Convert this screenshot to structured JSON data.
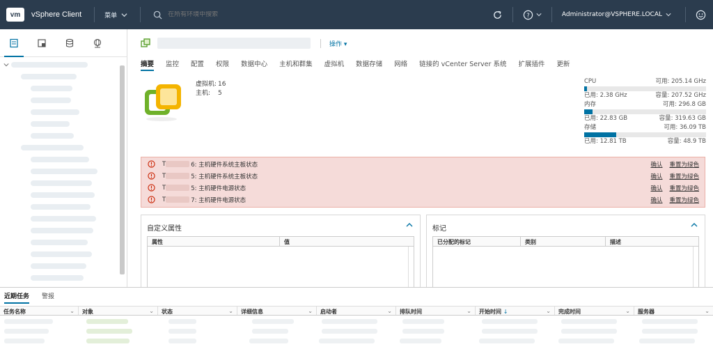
{
  "header": {
    "logo": "vm",
    "app_title": "vSphere Client",
    "menu_label": "菜单",
    "search_placeholder": "在所有环境中搜索",
    "user_label": "Administrator@VSPHERE.LOCAL",
    "icons": [
      "refresh-icon",
      "help-icon",
      "smiley-icon"
    ]
  },
  "navigator": {
    "tabs": [
      "hosts-clusters-icon",
      "vms-templates-icon",
      "storage-icon",
      "networking-icon"
    ],
    "active_tab_index": 0
  },
  "object": {
    "actions_label": "操作"
  },
  "tabs": [
    "摘要",
    "监控",
    "配置",
    "权限",
    "数据中心",
    "主机和群集",
    "虚拟机",
    "数据存储",
    "网络",
    "链接的 vCenter Server 系统",
    "扩展插件",
    "更新"
  ],
  "active_tab_index": 0,
  "summary": {
    "stats": [
      {
        "label": "虚拟机:",
        "value": "16"
      },
      {
        "label": "主机:",
        "value": "5"
      }
    ]
  },
  "resources": [
    {
      "name": "CPU",
      "free_label": "可用: 205.14 GHz",
      "used_label": "已用: 2.38 GHz",
      "capacity_label": "容量: 207.52 GHz",
      "used_fraction": 0.011
    },
    {
      "name": "内存",
      "free_label": "可用: 296.8 GB",
      "used_label": "已用: 22.83 GB",
      "capacity_label": "容量: 319.63 GB",
      "used_fraction": 0.071
    },
    {
      "name": "存储",
      "free_label": "可用: 36.09 TB",
      "used_label": "已用: 12.81 TB",
      "capacity_label": "容量: 48.9 TB",
      "used_fraction": 0.262
    }
  ],
  "alerts": {
    "rows": [
      {
        "prefix": "T",
        "suffix": "6: 主机硬件系统主板状态"
      },
      {
        "prefix": "T",
        "suffix": "5: 主机硬件系统主板状态"
      },
      {
        "prefix": "T",
        "suffix": "5: 主机硬件电源状态"
      },
      {
        "prefix": "T",
        "suffix": "7: 主机硬件电源状态"
      }
    ],
    "ack_label": "确认",
    "reset_label": "重置为绿色"
  },
  "custom_attributes": {
    "title": "自定义属性",
    "columns": [
      "属性",
      "值"
    ]
  },
  "tags": {
    "title": "标记",
    "columns": [
      "已分配的标记",
      "类别",
      "描述"
    ]
  },
  "bottom": {
    "tabs": [
      "近期任务",
      "警报"
    ],
    "active_tab_index": 0,
    "columns": [
      "任务名称",
      "对象",
      "状态",
      "详细信息",
      "启动者",
      "排队时间",
      "开始时间",
      "完成时间",
      "服务器"
    ],
    "sort_indicator": "↓"
  }
}
